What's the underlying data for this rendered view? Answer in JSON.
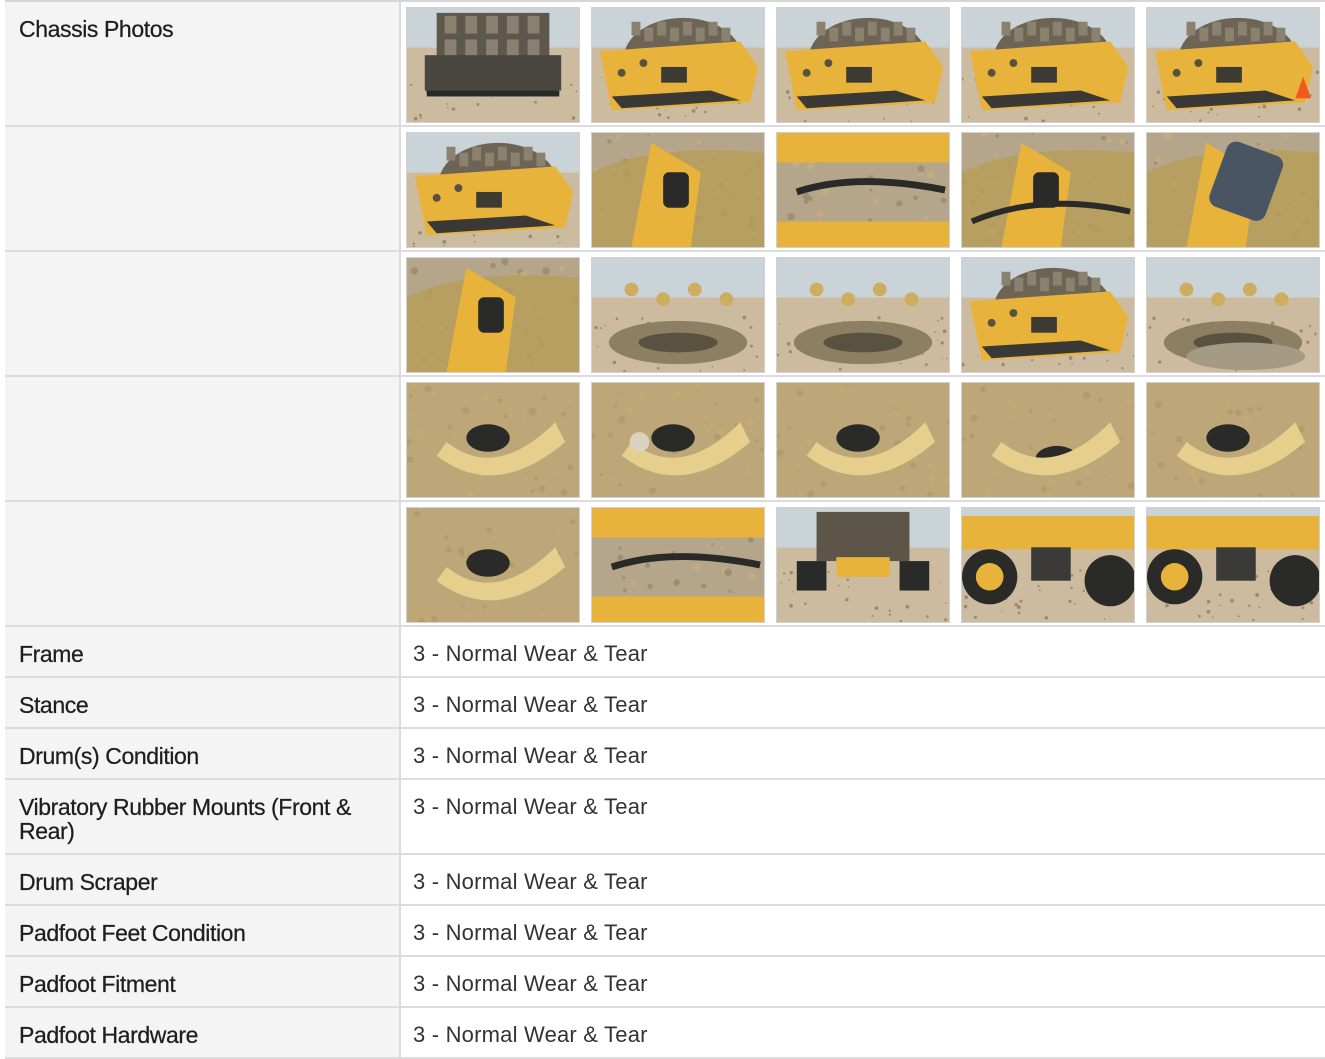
{
  "photos_section": {
    "label": "Chassis Photos",
    "photo_count": 25
  },
  "photo_themes": [
    [
      "drum-front",
      "drum-side",
      "drum-side-close",
      "drum-yard",
      "drum-yard-cone"
    ],
    [
      "drum-side",
      "mount-side",
      "scraper-hose",
      "mount-hose",
      "mount-plate"
    ],
    [
      "mount-bracket",
      "drum-inner",
      "drum-hub",
      "drum-side-yard",
      "drum-hub-dirt"
    ],
    [
      "mount-rubber",
      "mount-bolt",
      "mount-rubber",
      "mount-rubber-low",
      "mount-side-dirt"
    ],
    [
      "mount-under",
      "scraper-edge",
      "rear-view",
      "wheel-side",
      "wheel-under"
    ]
  ],
  "conditions": [
    {
      "label": "Frame",
      "value": "3 - Normal Wear & Tear"
    },
    {
      "label": "Stance",
      "value": "3 - Normal Wear & Tear"
    },
    {
      "label": "Drum(s) Condition",
      "value": "3 - Normal Wear & Tear"
    },
    {
      "label": "Vibratory Rubber Mounts (Front & Rear)",
      "value": "3 - Normal Wear & Tear"
    },
    {
      "label": "Drum Scraper",
      "value": "3 - Normal Wear & Tear"
    },
    {
      "label": "Padfoot Feet Condition",
      "value": "3 - Normal Wear & Tear"
    },
    {
      "label": "Padfoot Fitment",
      "value": "3 - Normal Wear & Tear"
    },
    {
      "label": "Padfoot Hardware",
      "value": "3 - Normal Wear & Tear"
    }
  ],
  "colors": {
    "machine_yellow": "#e8b33a",
    "dirt": "#b5a58a",
    "steel": "#6b6458",
    "sky": "#c9d3d8",
    "ground": "#cdbba0",
    "rubber": "#2a2a28",
    "label_bg": "#f4f4f4",
    "border": "#dcdcdc"
  }
}
